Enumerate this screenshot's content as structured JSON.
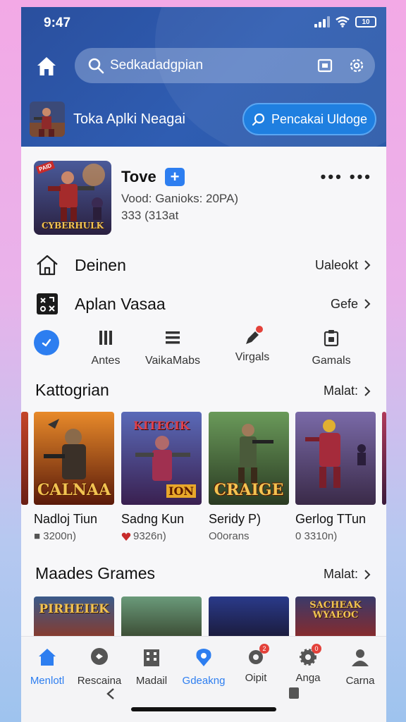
{
  "status": {
    "time": "9:47",
    "battery": "10"
  },
  "header": {
    "search_value": "Sedkadadgpian",
    "featured_label": "Toka Aplki Neagai",
    "update_button": "Pencakai Uldoge"
  },
  "app": {
    "title": "Tove",
    "badge": "+",
    "meta": "Vood: Ganioks: 20PA)",
    "size": "333 (313at",
    "icon_logo": "CYBERHULK",
    "icon_corner": "PAID"
  },
  "rows": [
    {
      "label": "Deinen",
      "right": "Ualeokt"
    },
    {
      "label": "Aplan Vasaa",
      "right": "Gefe"
    }
  ],
  "quick_actions": [
    {
      "label": "Antes",
      "icon": "bars-icon"
    },
    {
      "label": "VaikaMabs",
      "icon": "list-icon"
    },
    {
      "label": "Virgals",
      "icon": "pen-icon"
    },
    {
      "label": "Gamals",
      "icon": "clipboard-icon"
    }
  ],
  "sections": {
    "categories": {
      "title": "Kattogrian",
      "more": "Malat:"
    },
    "games": {
      "title": "Maades Grames",
      "more": "Malat:"
    }
  },
  "games": [
    {
      "name": "Nadloj Tiun",
      "sub": "■ 3200n)",
      "logo": "CALNAA",
      "top": ""
    },
    {
      "name": "Sadng  Kun",
      "sub": "9326n)",
      "logo": "ION",
      "top": "KITECIK"
    },
    {
      "name": "Seridy P)",
      "sub": "O0orans",
      "logo": "CRAIGE",
      "top": ""
    },
    {
      "name": "Gerlog TTun",
      "sub": "0 3310n)",
      "logo": "",
      "top": ""
    }
  ],
  "games2": [
    {
      "logo": "PIRHEIEK"
    },
    {
      "logo": ""
    },
    {
      "logo": ""
    },
    {
      "logo": "SACHEAK WYAEOC"
    }
  ],
  "nav": [
    {
      "label": "Menlotl",
      "icon": "home-icon",
      "active": false
    },
    {
      "label": "Rescaina",
      "icon": "chat-icon",
      "active": false
    },
    {
      "label": "Madail",
      "icon": "building-icon",
      "active": false
    },
    {
      "label": "Gdeakng",
      "icon": "location-icon",
      "active": true
    },
    {
      "label": "Oipit",
      "icon": "gear-icon",
      "active": false
    },
    {
      "label": "Anga",
      "icon": "settings-icon",
      "active": false
    },
    {
      "label": "Carna",
      "icon": "person-icon",
      "active": false
    }
  ],
  "colors": {
    "accent": "#2d7ef0",
    "header": "#2f5db2",
    "badge": "#e3413a"
  }
}
